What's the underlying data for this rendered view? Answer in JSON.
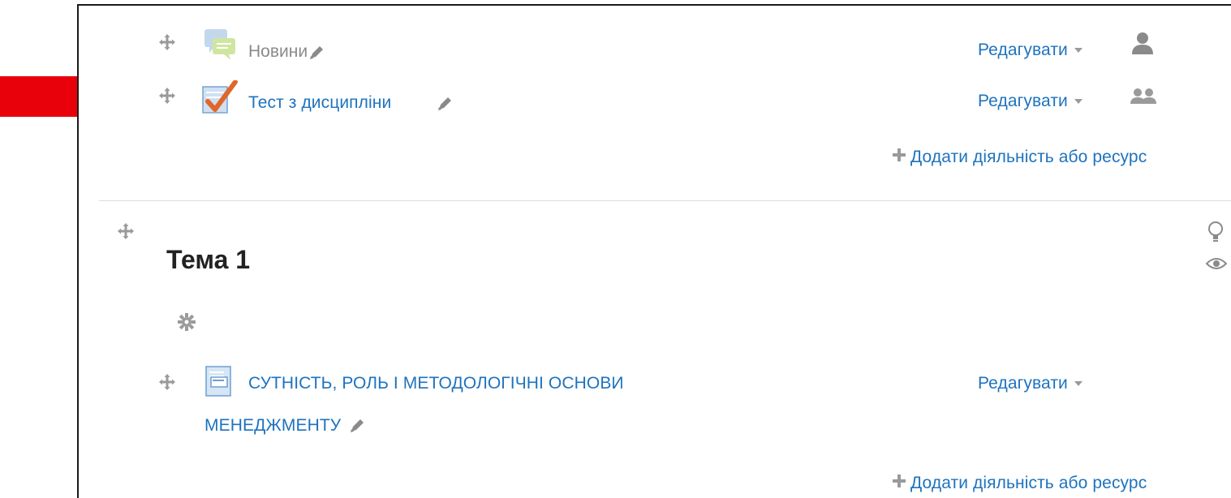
{
  "colors": {
    "link": "#1e73be",
    "muted": "#8a8a8a",
    "icon_gray": "#9a9a9a",
    "arrow_red": "#e8000b",
    "check_orange": "#e0662a"
  },
  "section0": {
    "activities": [
      {
        "name": "Новини",
        "icon": "forum-icon",
        "edit_label": "Редагувати",
        "group_icon": "single-user-icon"
      },
      {
        "name": "Тест з дисципліни",
        "icon": "quiz-checkmark-icon",
        "edit_label": "Редагувати",
        "group_icon": "group-users-icon"
      }
    ],
    "add_activity_label": "Додати діяльність або ресурс"
  },
  "section1": {
    "title": "Тема 1",
    "activities": [
      {
        "name_line1": "СУТНІСТЬ, РОЛЬ І МЕТОДОЛОГІЧНІ ОСНОВИ",
        "name_line2": "МЕНЕДЖМЕНТУ",
        "icon": "page-resource-icon",
        "edit_label": "Редагувати"
      }
    ],
    "add_activity_label": "Додати діяльність або ресурс"
  },
  "annotation": {
    "icon": "red-arrow-icon"
  }
}
